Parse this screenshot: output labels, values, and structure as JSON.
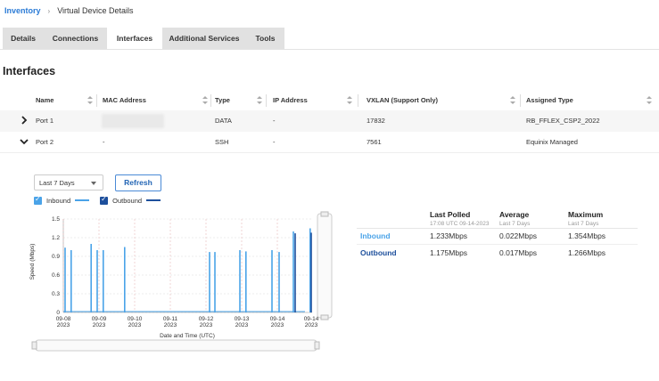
{
  "breadcrumb": {
    "root": "Inventory",
    "current": "Virtual Device Details"
  },
  "tabs": [
    {
      "label": "Details",
      "active": false
    },
    {
      "label": "Connections",
      "active": false
    },
    {
      "label": "Interfaces",
      "active": true
    },
    {
      "label": "Additional Services",
      "active": false
    },
    {
      "label": "Tools",
      "active": false
    }
  ],
  "section_title": "Interfaces",
  "table": {
    "columns": [
      "Name",
      "MAC Address",
      "Type",
      "IP Address",
      "VXLAN (Support Only)",
      "Assigned Type"
    ],
    "rows": [
      {
        "name": "Port 1",
        "mac": "",
        "type": "DATA",
        "ip": "-",
        "vxlan": "17832",
        "assigned": "RB_FFLEX_CSP2_2022",
        "expanded": false
      },
      {
        "name": "Port 2",
        "mac": "-",
        "type": "SSH",
        "ip": "-",
        "vxlan": "7561",
        "assigned": "Equinix Managed",
        "expanded": true
      }
    ]
  },
  "controls": {
    "range": "Last 7 Days",
    "refresh": "Refresh"
  },
  "legend": {
    "inbound": "Inbound",
    "outbound": "Outbound"
  },
  "colors": {
    "inbound": "#4aa3e8",
    "outbound": "#1d4f9c",
    "link": "#2b7bd6"
  },
  "stats": {
    "headers": [
      {
        "title": "Last Polled",
        "sub": "17:08 UTC 09-14-2023"
      },
      {
        "title": "Average",
        "sub": "Last 7 Days"
      },
      {
        "title": "Maximum",
        "sub": "Last 7 Days"
      }
    ],
    "rows": [
      {
        "label": "Inbound",
        "last": "1.233Mbps",
        "avg": "0.022Mbps",
        "max": "1.354Mbps"
      },
      {
        "label": "Outbound",
        "last": "1.175Mbps",
        "avg": "0.017Mbps",
        "max": "1.266Mbps"
      }
    ]
  },
  "chart_data": {
    "type": "bar",
    "xlabel": "Date and Time (UTC)",
    "ylabel": "Speed (Mbps)",
    "ylim": [
      0,
      1.5
    ],
    "yticks": [
      "0",
      "0.3",
      "0.6",
      "0.9",
      "1.2",
      "1.5"
    ],
    "xticks": [
      {
        "day": "09-08",
        "year": "2023"
      },
      {
        "day": "09-09",
        "year": "2023"
      },
      {
        "day": "09-10",
        "year": "2023"
      },
      {
        "day": "09-11",
        "year": "2023"
      },
      {
        "day": "09-12",
        "year": "2023"
      },
      {
        "day": "09-13",
        "year": "2023"
      },
      {
        "day": "09-14",
        "year": "2023"
      },
      {
        "day": "09-14",
        "year": "2023"
      }
    ],
    "grid": true,
    "series": [
      {
        "name": "Inbound",
        "points": [
          {
            "day": 0.05,
            "value": 1.04
          },
          {
            "day": 0.22,
            "value": 1.0
          },
          {
            "day": 0.78,
            "value": 1.1
          },
          {
            "day": 0.95,
            "value": 1.0
          },
          {
            "day": 1.12,
            "value": 1.0
          },
          {
            "day": 1.72,
            "value": 1.05
          },
          {
            "day": 4.1,
            "value": 0.97
          },
          {
            "day": 4.25,
            "value": 0.97
          },
          {
            "day": 4.95,
            "value": 1.0
          },
          {
            "day": 5.12,
            "value": 0.98
          },
          {
            "day": 5.85,
            "value": 1.0
          },
          {
            "day": 6.05,
            "value": 0.97
          },
          {
            "day": 6.45,
            "value": 1.3
          },
          {
            "day": 6.92,
            "value": 1.35
          }
        ]
      },
      {
        "name": "Outbound",
        "points": [
          {
            "day": 6.5,
            "value": 1.27
          },
          {
            "day": 6.95,
            "value": 1.28
          }
        ]
      }
    ]
  }
}
